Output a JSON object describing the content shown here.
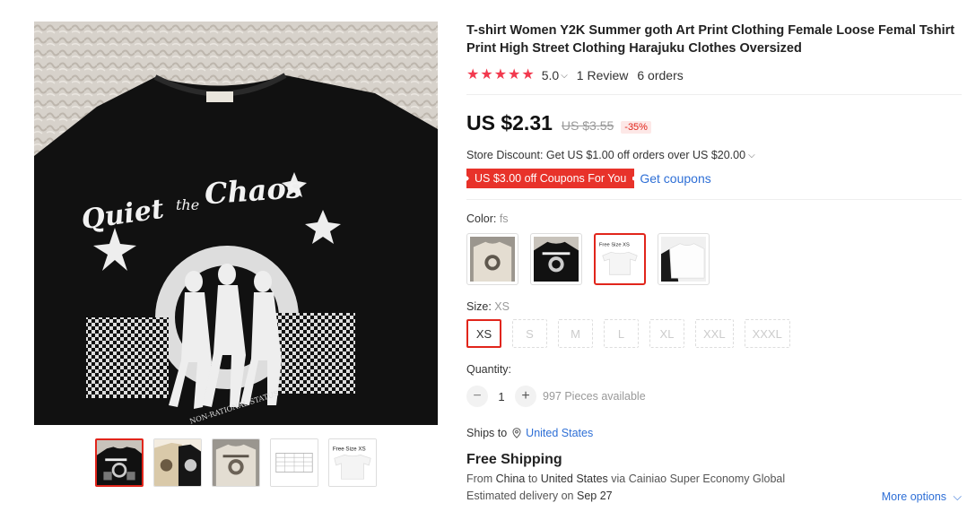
{
  "product": {
    "title": "T-shirt Women Y2K Summer goth Art Print Clothing Female Loose Femal Tshirt Print High Street Clothing Harajuku Clothes Oversized",
    "rating": "5.0",
    "reviews": "1 Review",
    "orders": "6 orders",
    "stars": 5
  },
  "price": {
    "current": "US $2.31",
    "original": "US $3.55",
    "discount": "-35%"
  },
  "promo": {
    "store_discount": "Store Discount: Get US $1.00 off orders over US $20.00",
    "coupon": "US $3.00 off Coupons For You",
    "get_coupons": "Get coupons"
  },
  "color": {
    "label": "Color:",
    "selected": "fs"
  },
  "size": {
    "label": "Size:",
    "selected": "XS",
    "options": [
      "XS",
      "S",
      "M",
      "L",
      "XL",
      "XXL",
      "XXXL"
    ]
  },
  "quantity": {
    "label": "Quantity:",
    "value": "1",
    "minus": "−",
    "plus": "+",
    "available": "997 Pieces available"
  },
  "shipping": {
    "ships_to_label": "Ships to",
    "ships_to": "United States",
    "free_shipping": "Free Shipping",
    "from_prefix": "From",
    "from": "China",
    "to_prefix": "to",
    "to": "United States",
    "via": "via Cainiao Super Economy Global",
    "estimated_prefix": "Estimated delivery on",
    "estimated_date": "Sep 27",
    "more_options": "More options"
  },
  "image_text": {
    "shirt_slogan_1": "Quiet",
    "shirt_slogan_2": "the",
    "shirt_slogan_3": "Chaos",
    "shirt_arc": "NON-RATIONAL STATUS",
    "size_thumb": "Free Size XS"
  },
  "colors": {
    "accent": "#e1251b",
    "link": "#2e6fd6",
    "star": "#f2394e",
    "shirt": "#111111"
  }
}
